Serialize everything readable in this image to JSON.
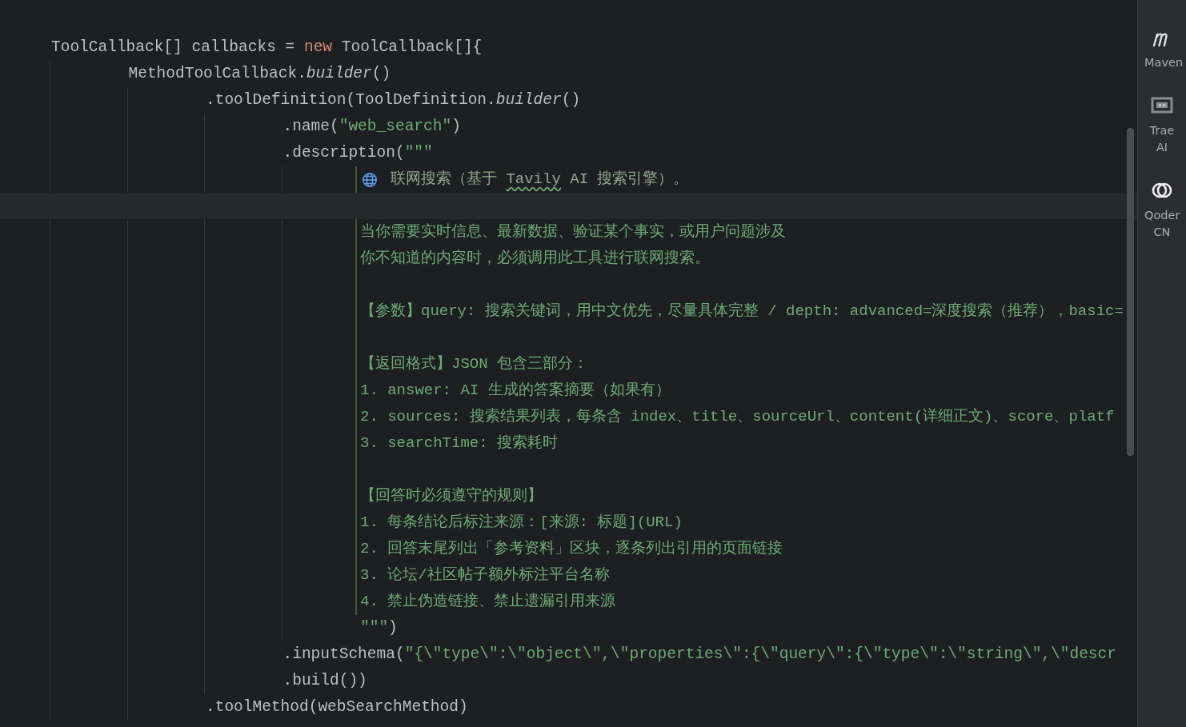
{
  "editor": {
    "code": [
      {
        "segments": [
          {
            "text": "ToolCallback[] callbacks = ",
            "kind": "plain"
          },
          {
            "text": "new",
            "kind": "keyword"
          },
          {
            "text": " ToolCallback[]{",
            "kind": "plain"
          }
        ],
        "children": [
          {
            "segments": [
              {
                "text": "MethodToolCallback.",
                "kind": "plain"
              },
              {
                "text": "builder",
                "kind": "italic"
              },
              {
                "text": "()",
                "kind": "plain"
              }
            ],
            "children": [
              {
                "segments": [
                  {
                    "text": ".toolDefinition(ToolDefinition.",
                    "kind": "plain"
                  },
                  {
                    "text": "builder",
                    "kind": "italic"
                  },
                  {
                    "text": "()",
                    "kind": "plain"
                  }
                ],
                "children": [
                  {
                    "segments": [
                      {
                        "text": ".name(",
                        "kind": "plain"
                      },
                      {
                        "text": "\"web_search\"",
                        "kind": "string"
                      },
                      {
                        "text": ")",
                        "kind": "plain"
                      }
                    ]
                  },
                  {
                    "segments": [
                      {
                        "text": ".description(",
                        "kind": "plain"
                      },
                      {
                        "text": "\"\"\"",
                        "kind": "string"
                      }
                    ],
                    "children": [
                      {
                        "kind": "text_block",
                        "lines": [
                          {
                            "kind": "marked",
                            "current": false,
                            "segments": [
                              {
                                "text": "联网搜索（基于 ",
                                "typo": false
                              },
                              {
                                "text": "Tavily",
                                "typo": true
                              },
                              {
                                "text": " AI 搜索引擎）。",
                                "typo": false
                              }
                            ]
                          },
                          {
                            "kind": "blank",
                            "current": true
                          },
                          {
                            "kind": "doc",
                            "current": false,
                            "segments": [
                              {
                                "text": "当你需要实时信息、最新数据、验证某个事实，或用户问题涉及",
                                "typo": false
                              }
                            ]
                          },
                          {
                            "kind": "doc",
                            "current": false,
                            "segments": [
                              {
                                "text": "你不知道的内容时，必须调用此工具进行联网搜索。",
                                "typo": false
                              }
                            ]
                          },
                          {
                            "kind": "blank",
                            "current": false
                          },
                          {
                            "kind": "doc",
                            "current": false,
                            "segments": [
                              {
                                "text": "【参数】query: 搜索关键词，用中文优先，尽量具体完整 / depth: advanced=深度搜索（推荐），basic=",
                                "typo": false
                              }
                            ]
                          },
                          {
                            "kind": "blank",
                            "current": false
                          },
                          {
                            "kind": "doc",
                            "current": false,
                            "segments": [
                              {
                                "text": "【返回格式】JSON 包含三部分：",
                                "typo": false
                              }
                            ]
                          },
                          {
                            "kind": "doc",
                            "current": false,
                            "segments": [
                              {
                                "text": "1. answer: AI 生成的答案摘要（如果有）",
                                "typo": false
                              }
                            ]
                          },
                          {
                            "kind": "doc",
                            "current": false,
                            "segments": [
                              {
                                "text": "2. sources: 搜索结果列表，每条含 index、title、sourceUrl、content(详细正文)、score、platf",
                                "typo": false
                              }
                            ]
                          },
                          {
                            "kind": "doc",
                            "current": false,
                            "segments": [
                              {
                                "text": "3. searchTime: 搜索耗时",
                                "typo": false
                              }
                            ]
                          },
                          {
                            "kind": "blank",
                            "current": false
                          },
                          {
                            "kind": "doc",
                            "current": false,
                            "segments": [
                              {
                                "text": "【回答时必须遵守的规则】",
                                "typo": false
                              }
                            ]
                          },
                          {
                            "kind": "doc",
                            "current": false,
                            "segments": [
                              {
                                "text": "1. 每条结论后标注来源：[来源: 标题](URL)",
                                "typo": false
                              }
                            ]
                          },
                          {
                            "kind": "doc",
                            "current": false,
                            "segments": [
                              {
                                "text": "2. 回答末尾列出「参考资料」区块，逐条列出引用的页面链接",
                                "typo": false
                              }
                            ]
                          },
                          {
                            "kind": "doc",
                            "current": false,
                            "segments": [
                              {
                                "text": "3. 论坛/社区帖子额外标注平台名称",
                                "typo": false
                              }
                            ]
                          },
                          {
                            "kind": "doc",
                            "current": false,
                            "segments": [
                              {
                                "text": "4. 禁止伪造链接、禁止遗漏引用来源",
                                "typo": false
                              }
                            ]
                          }
                        ]
                      },
                      {
                        "segments": [
                          {
                            "text": "\"\"\"",
                            "kind": "string"
                          },
                          {
                            "text": ")",
                            "kind": "plain"
                          }
                        ]
                      }
                    ]
                  },
                  {
                    "segments": [
                      {
                        "text": ".inputSchema(",
                        "kind": "plain"
                      },
                      {
                        "text": "\"{\\\"type\\\":\\\"object\\\",\\\"properties\\\":{\\\"query\\\":{\\\"type\\\":\\\"string\\\",\\\"descr",
                        "kind": "string"
                      }
                    ]
                  },
                  {
                    "segments": [
                      {
                        "text": ".build())",
                        "kind": "plain"
                      }
                    ]
                  }
                ]
              },
              {
                "segments": [
                  {
                    "text": ".toolMethod(webSearchMethod)",
                    "kind": "plain"
                  }
                ]
              }
            ]
          }
        ]
      }
    ]
  },
  "sidebar": {
    "items": [
      {
        "label": "Maven"
      },
      {
        "label": "Trae AI"
      },
      {
        "label": "Qoder CN"
      }
    ]
  }
}
